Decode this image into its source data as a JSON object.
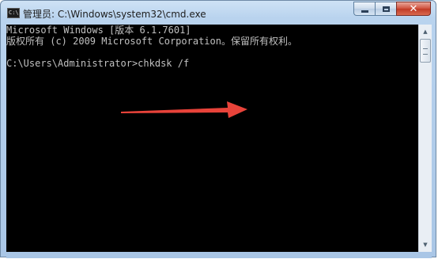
{
  "window": {
    "title": "管理员: C:\\Windows\\system32\\cmd.exe",
    "app_icon_text": "C:\\."
  },
  "caption_buttons": {
    "minimize": "minimize-icon",
    "maximize": "maximize-icon",
    "close_glyph": "✕"
  },
  "console": {
    "lines": [
      "Microsoft Windows [版本 6.1.7601]",
      "版权所有 (c) 2009 Microsoft Corporation。保留所有权利。",
      "",
      "C:\\Users\\Administrator>chkdsk /f"
    ]
  },
  "scrollbar": {
    "up_arrow": "▲",
    "down_arrow": "▼"
  },
  "colors": {
    "annotation_arrow": "#e8433a",
    "console_bg": "#000000",
    "console_text": "#c0c0c0"
  }
}
